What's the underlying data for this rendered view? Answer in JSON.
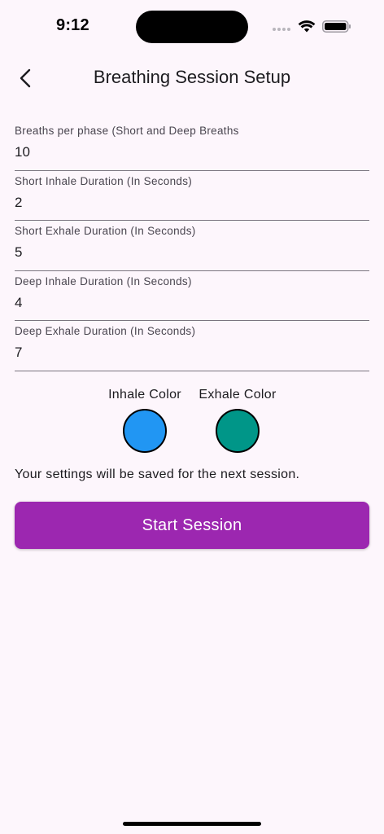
{
  "status_bar": {
    "time": "9:12",
    "icons": [
      "signal-dots-icon",
      "wifi-icon",
      "battery-icon"
    ]
  },
  "app_bar": {
    "back_icon": "chevron-left-icon",
    "title": "Breathing Session Setup"
  },
  "fields": [
    {
      "label": "Breaths per phase (Short and Deep Breaths",
      "value": "10"
    },
    {
      "label": "Short Inhale Duration (In Seconds)",
      "value": "2"
    },
    {
      "label": "Short Exhale Duration (In Seconds)",
      "value": "5"
    },
    {
      "label": "Deep Inhale Duration (In Seconds)",
      "value": "4"
    },
    {
      "label": "Deep Exhale Duration (In Seconds)",
      "value": "7"
    }
  ],
  "colors": {
    "inhale_label": "Inhale Color",
    "inhale_color": "#2196f3",
    "exhale_label": "Exhale Color",
    "exhale_color": "#009688"
  },
  "save_note": "Your settings will be saved for the next session.",
  "start_button": {
    "label": "Start Session",
    "color": "#9c27b0"
  }
}
